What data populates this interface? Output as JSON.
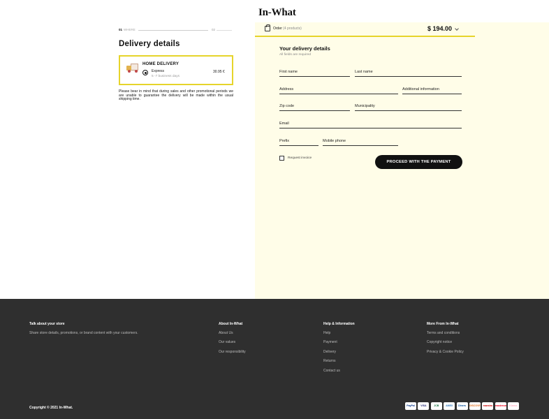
{
  "brand": "In-What",
  "steps": {
    "step1_num": "01",
    "step1_label": "WHERE",
    "step2_num": "02"
  },
  "delivery": {
    "title": "Delivery details",
    "option_title": "HOME DELIVERY",
    "method": "Express",
    "duration": "5 -7 business days",
    "price": "30.95 €",
    "notice": "Please bear in mind that during sales and other promotional periods we are unable to guarantee the delivery will be made within the usual shipping time."
  },
  "order": {
    "label": "Order",
    "count": "(4 products)",
    "total": "$ 194.00"
  },
  "form": {
    "title": "Your delivery details",
    "subtitle": "All fields are required",
    "first_name": "First name",
    "last_name": "Last name",
    "address": "Address",
    "additional": "Additional information",
    "zip": "Zip code",
    "municipality": "Municipality",
    "email": "Email",
    "prefix": "Prefix",
    "mobile": "Mobile phone",
    "invoice": "Request invoice",
    "proceed": "PROCEED WITH THE PAYMENT"
  },
  "footer": {
    "col1": {
      "title": "Talk about your store",
      "text": "Share store details, promotions, or brand content with your customers."
    },
    "col2": {
      "title": "About In-What",
      "links": [
        "About Us",
        "Our values",
        "Our responsibility"
      ]
    },
    "col3": {
      "title": "Help & Information",
      "links": [
        "Help",
        "Payment",
        "Delivery",
        "Returns",
        "Contact us"
      ]
    },
    "col4": {
      "title": "More From In-What",
      "links": [
        "Terms and conditions",
        "Copyright notice",
        "Privacy & Cookie Policy"
      ]
    },
    "copyright": "Copyright © 2021 In-What.",
    "payments": [
      {
        "icon": "paypal-icon",
        "label": "PayPal",
        "color": "#003087"
      },
      {
        "icon": "visa-icon",
        "label": "VISA",
        "color": "#1a1f71"
      },
      {
        "icon": "jcb-icon",
        "label": "JCB",
        "color": "#0b6e3a"
      },
      {
        "icon": "amex-icon",
        "label": "AMEX",
        "color": "#2e77bb"
      },
      {
        "icon": "diners-icon",
        "label": "Diners",
        "color": "#004a97"
      },
      {
        "icon": "discover-icon",
        "label": "DISCOVER",
        "color": "#e36f1e"
      },
      {
        "icon": "maestro-icon",
        "label": "maestro",
        "color": "#cc0000"
      },
      {
        "icon": "mastercard-icon",
        "label": "mastercard",
        "color": "#eb001b"
      },
      {
        "icon": "klarna-icon",
        "label": "Klarna.",
        "color": "#ffb3c7"
      }
    ]
  }
}
